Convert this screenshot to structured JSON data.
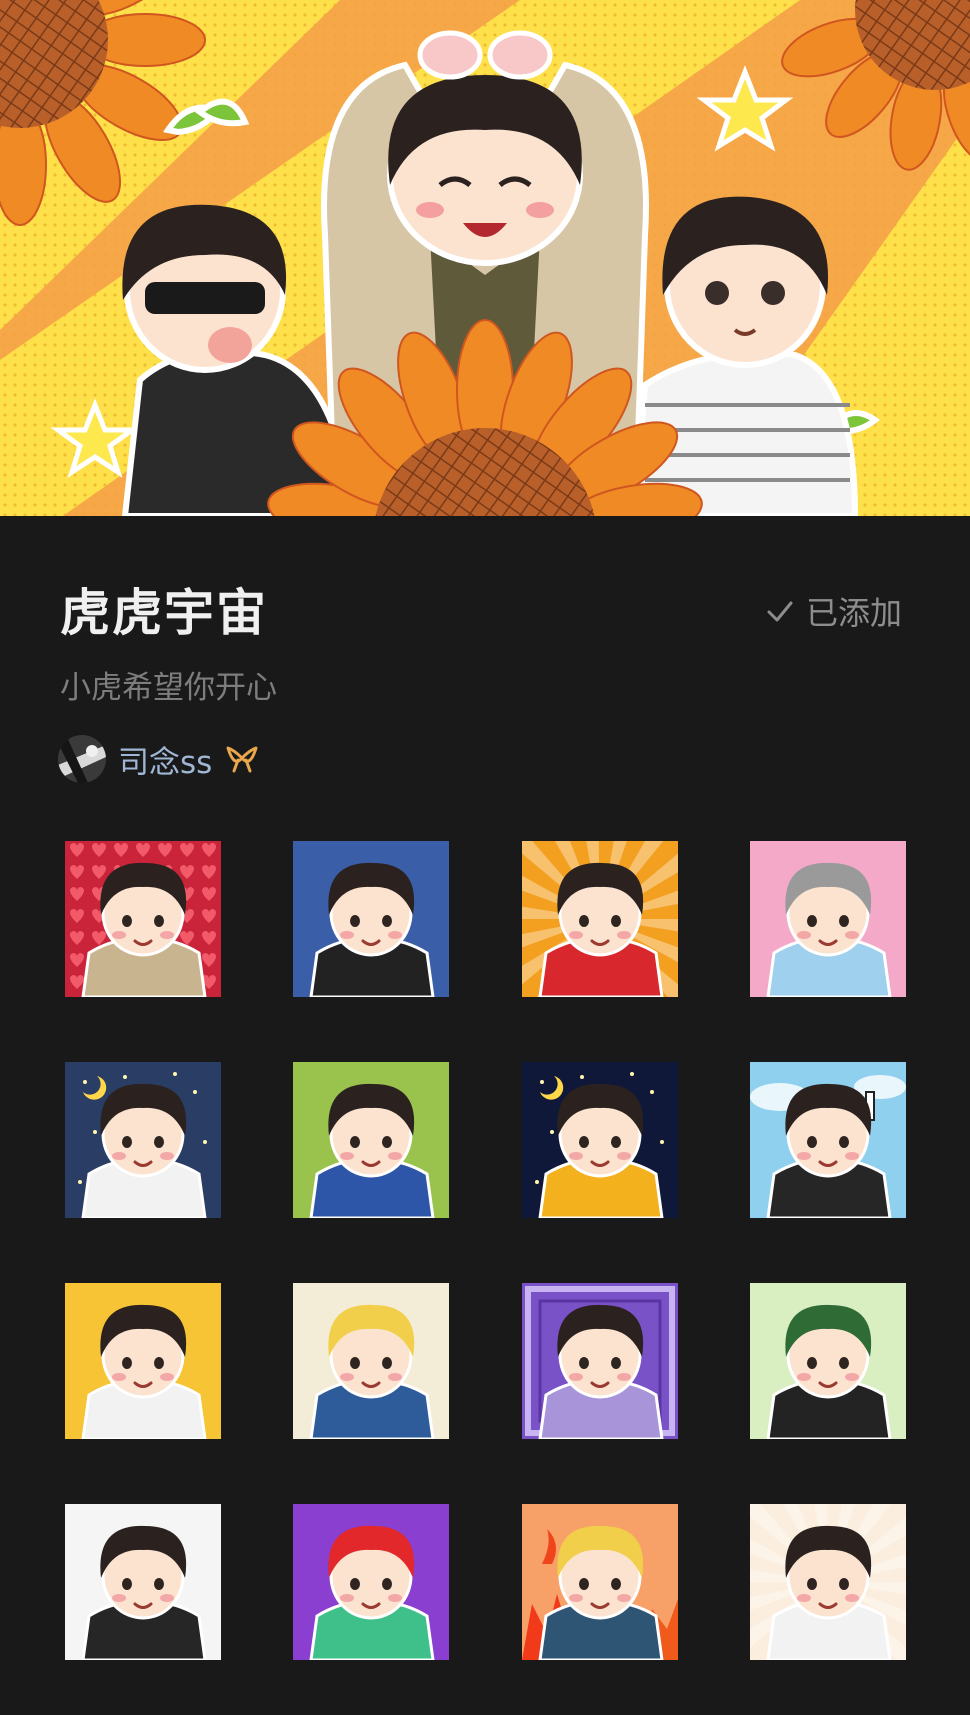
{
  "pack": {
    "title": "虎虎宇宙",
    "subtitle": "小虎希望你开心",
    "added_label": "已添加",
    "author": {
      "name": "司念ss",
      "badge_icon": "ribbon-icon",
      "badge_color": "#e9a64a"
    }
  },
  "banner": {
    "description_icon": "sunflower-banner-icon"
  },
  "colors": {
    "background": "#191919",
    "title": "#f0f0f0",
    "muted": "#7d7d7d",
    "author": "#9fb6d4"
  },
  "stickers": [
    {
      "id": 1,
      "bg": "#c9243a",
      "pattern": "hearts",
      "hair": "#2b2220",
      "shirt": "#c8b48f",
      "selected": false
    },
    {
      "id": 2,
      "bg": "#3b5ea8",
      "pattern": "plain",
      "hair": "#2b2220",
      "shirt": "#222222",
      "selected": false
    },
    {
      "id": 3,
      "bg": "#f3a021",
      "pattern": "rays",
      "hair": "#2b2220",
      "shirt": "#d8282d",
      "selected": false
    },
    {
      "id": 4,
      "bg": "#f4a9c8",
      "pattern": "plain",
      "hair": "#9a9a9a",
      "shirt": "#9fd0ee",
      "selected": false
    },
    {
      "id": 5,
      "bg": "#2a3d64",
      "pattern": "stars",
      "hair": "#2b2220",
      "shirt": "#f2f2f2",
      "selected": false
    },
    {
      "id": 6,
      "bg": "#9ac34e",
      "pattern": "plain",
      "hair": "#2b2220",
      "shirt": "#2d56a8",
      "selected": false
    },
    {
      "id": 7,
      "bg": "#0f1838",
      "pattern": "stars",
      "hair": "#2b2220",
      "shirt": "#f3b21d",
      "selected": false
    },
    {
      "id": 8,
      "bg": "#8fd0ef",
      "pattern": "clouds",
      "hair": "#2b2220",
      "shirt": "#262626",
      "selected": false
    },
    {
      "id": 9,
      "bg": "#f7c436",
      "pattern": "plain",
      "hair": "#2b2220",
      "shirt": "#f2f2f2",
      "selected": false
    },
    {
      "id": 10,
      "bg": "#f3ecd6",
      "pattern": "plain",
      "hair": "#f2cf4a",
      "shirt": "#2e5c9a",
      "selected": false
    },
    {
      "id": 11,
      "bg": "#7a52c8",
      "pattern": "frame",
      "hair": "#2b2220",
      "shirt": "#a894d8",
      "selected": false
    },
    {
      "id": 12,
      "bg": "#d9efc2",
      "pattern": "plain",
      "hair": "#2f6b35",
      "shirt": "#232323",
      "selected": false
    },
    {
      "id": 13,
      "bg": "#f5f5f5",
      "pattern": "plain",
      "hair": "#2b2220",
      "shirt": "#262626",
      "selected": false
    },
    {
      "id": 14,
      "bg": "#8a3fd0",
      "pattern": "plain",
      "hair": "#e2282a",
      "shirt": "#3fc08a",
      "selected": false
    },
    {
      "id": 15,
      "bg": "#f7a067",
      "pattern": "fire",
      "hair": "#f2cf4a",
      "shirt": "#2f5574",
      "selected": false
    },
    {
      "id": 16,
      "bg": "#fbeede",
      "pattern": "rays",
      "hair": "#2b2220",
      "shirt": "#f2f2f2",
      "selected": true
    }
  ]
}
